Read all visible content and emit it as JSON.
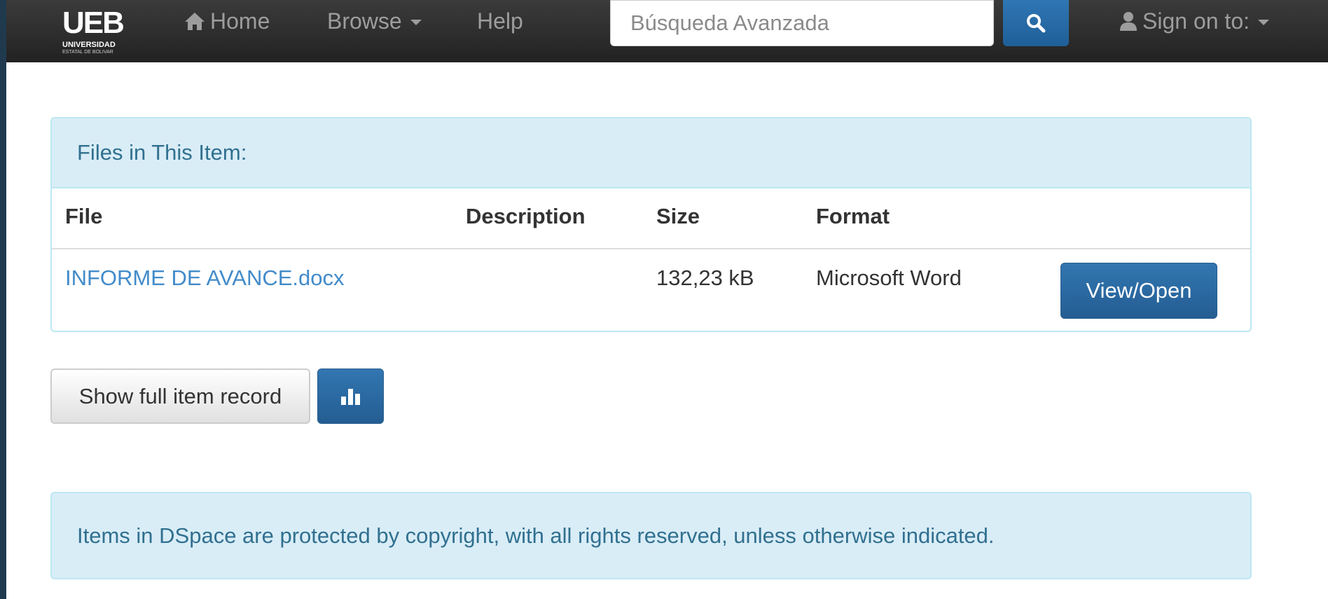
{
  "navbar": {
    "logo": {
      "main": "UEB",
      "sub": "UNIVERSIDAD",
      "sub2": "ESTATAL DE BOLIVAR"
    },
    "home_label": "Home",
    "browse_label": "Browse",
    "help_label": "Help",
    "search_placeholder": "Búsqueda Avanzada",
    "signin_label": "Sign on to:"
  },
  "files_panel": {
    "heading": "Files in This Item:",
    "columns": {
      "file": "File",
      "description": "Description",
      "size": "Size",
      "format": "Format"
    },
    "rows": [
      {
        "file": "INFORME DE AVANCE.docx",
        "description": "",
        "size": "132,23 kB",
        "format": "Microsoft Word",
        "action": "View/Open"
      }
    ]
  },
  "actions": {
    "full_record_label": "Show full item record"
  },
  "footer_alert": "Items in DSpace are protected by copyright, with all rights reserved, unless otherwise indicated.",
  "colors": {
    "navbar": "#222222",
    "primary": "#3276b1",
    "info_bg": "#d9edf7",
    "info_text": "#31708f",
    "link": "#428bca"
  }
}
